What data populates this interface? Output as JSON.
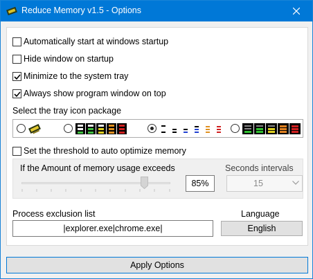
{
  "window": {
    "title": "Reduce Memory v1.5 - Options",
    "titlebar_color": "#0078d7"
  },
  "options": {
    "autostart_label": "Automatically start at windows startup",
    "autostart_checked": false,
    "hide_label": "Hide window on startup",
    "hide_checked": false,
    "minimize_label": "Minimize to the system tray",
    "minimize_checked": true,
    "ontop_label": "Always show program window on top",
    "ontop_checked": true
  },
  "tray": {
    "label": "Select the tray icon package",
    "selected_index": 2,
    "packages": [
      "memory-chip-icon",
      "color-bars-icon",
      "mini-bars-icon",
      "dark-bars-icon"
    ]
  },
  "threshold": {
    "checkbox_label": "Set the threshold to auto optimize memory",
    "checked": false,
    "amount_label": "If the Amount of memory usage exceeds",
    "percent_value": "85%",
    "slider_level_percent": 85,
    "seconds_label": "Seconds intervals",
    "seconds_value": "15"
  },
  "exclusion": {
    "label": "Process exclusion list",
    "value": "|explorer.exe|chrome.exe|"
  },
  "language": {
    "label": "Language",
    "value": "English"
  },
  "apply_label": "Apply Options"
}
